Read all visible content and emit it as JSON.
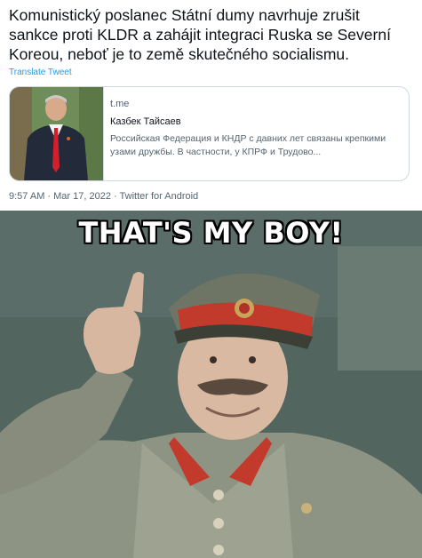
{
  "tweet": {
    "text_lines": [
      "Komunistický poslanec Státní dumy navrhuje zrušit",
      "sankce proti KLDR a zahájit integraci Ruska se Severní",
      "Koreou, neboť je to země skutečného socialismu."
    ],
    "translate_label": "Translate Tweet",
    "card": {
      "domain": "t.me",
      "title": "Казбек Тайсаев",
      "description": "Российская Федерация и КНДР с давних лет связаны крепкими узами дружбы. В частности, у КПРФ и Трудово..."
    },
    "meta": "9:57 AM · Mar 17, 2022 · Twitter for Android"
  },
  "meme": {
    "caption": "THAT'S MY BOY!"
  },
  "colors": {
    "link": "#1d9bf0",
    "text": "#0f1419",
    "muted": "#536471",
    "border": "#cfd9de"
  }
}
